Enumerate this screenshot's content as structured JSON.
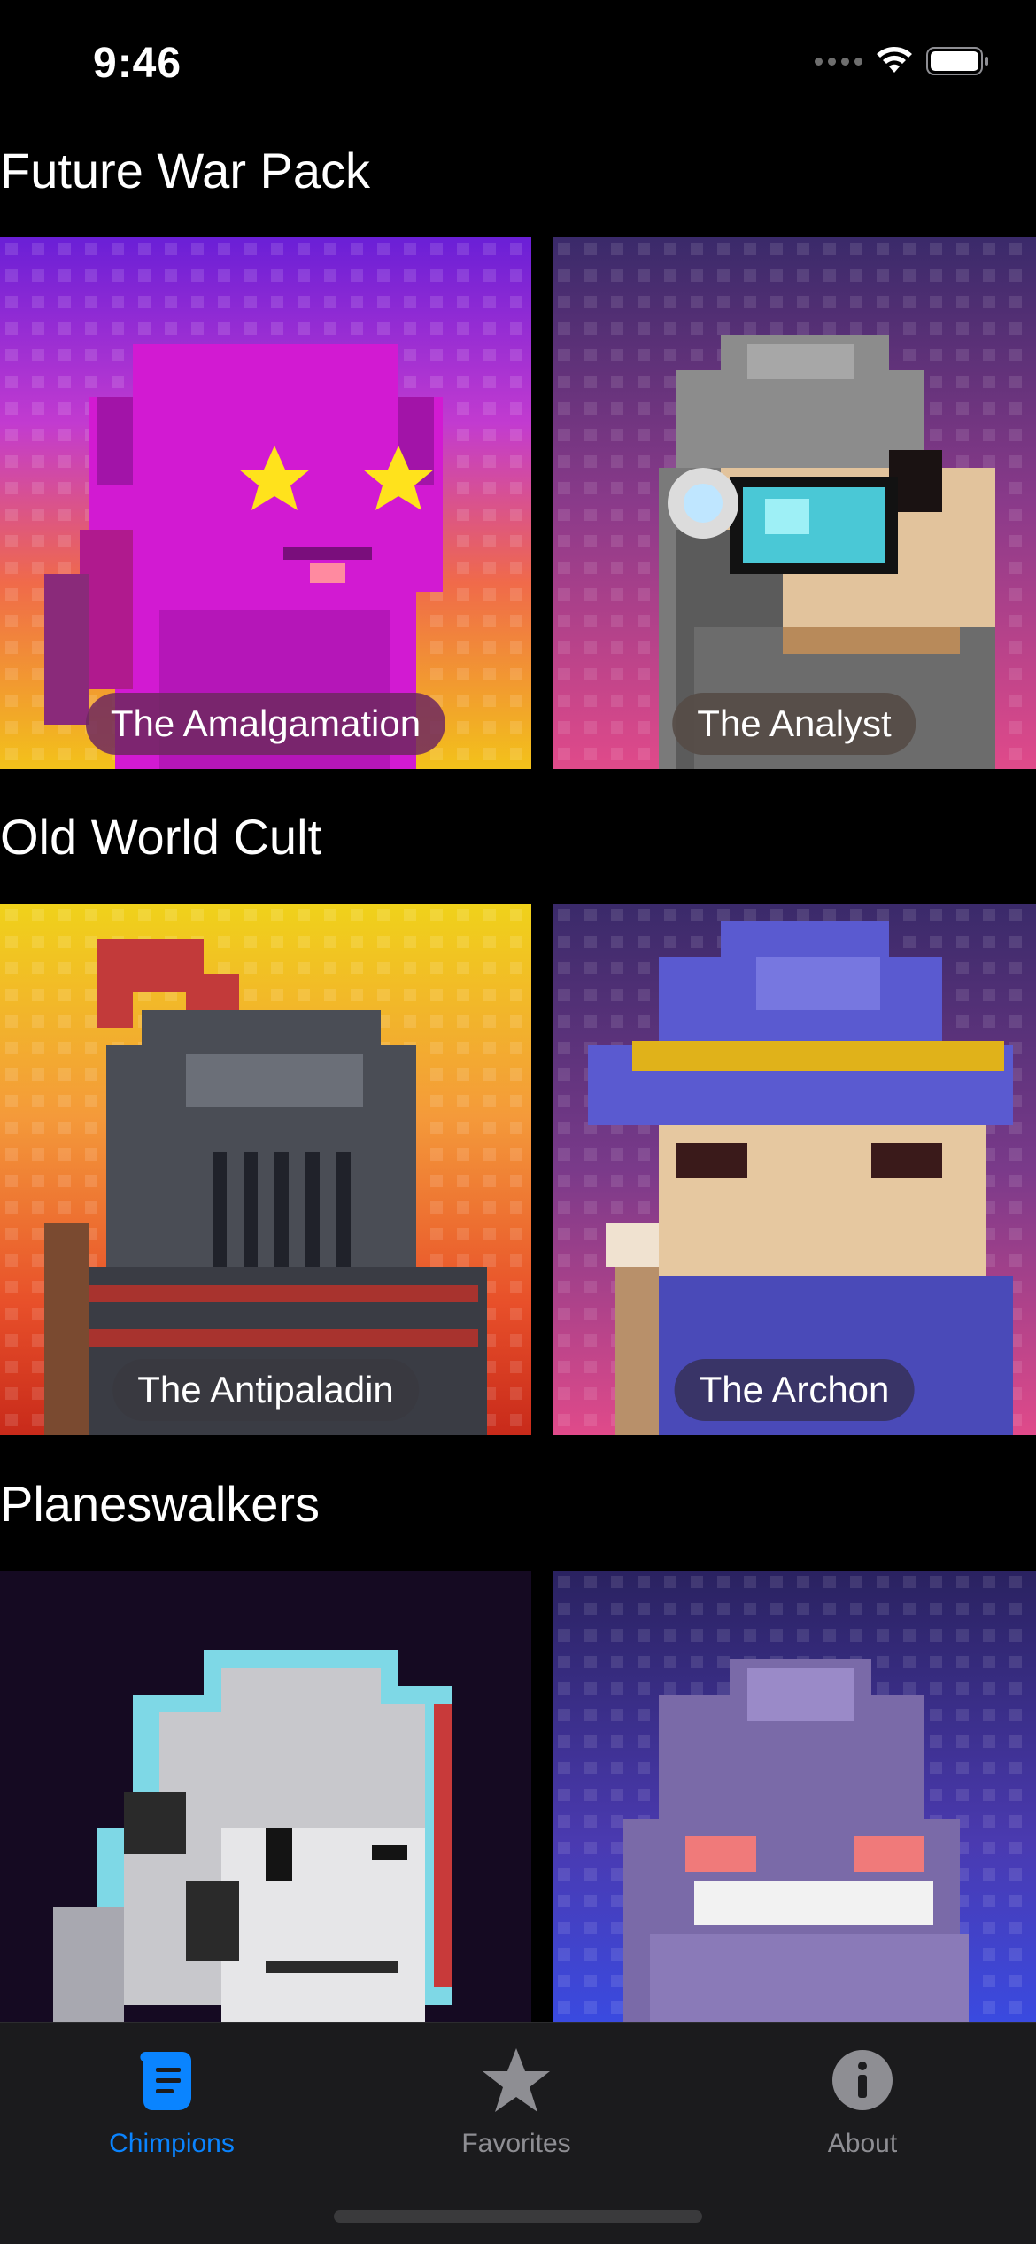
{
  "status_bar": {
    "time": "9:46"
  },
  "sections": [
    {
      "title": "Future War Pack",
      "champions": [
        {
          "name": "The Amalgamation"
        },
        {
          "name": "The Analyst"
        }
      ]
    },
    {
      "title": "Old World Cult",
      "champions": [
        {
          "name": "The Antipaladin"
        },
        {
          "name": "The Archon"
        }
      ]
    },
    {
      "title": "Planeswalkers",
      "champions": [
        {
          "name": ""
        },
        {
          "name": ""
        }
      ]
    }
  ],
  "tab_bar": {
    "tabs": [
      {
        "label": "Chimpions",
        "icon": "scroll-icon",
        "selected": true
      },
      {
        "label": "Favorites",
        "icon": "star-icon",
        "selected": false
      },
      {
        "label": "About",
        "icon": "info-icon",
        "selected": false
      }
    ],
    "active_color": "#0a84ff",
    "inactive_color": "#8e8e93"
  }
}
